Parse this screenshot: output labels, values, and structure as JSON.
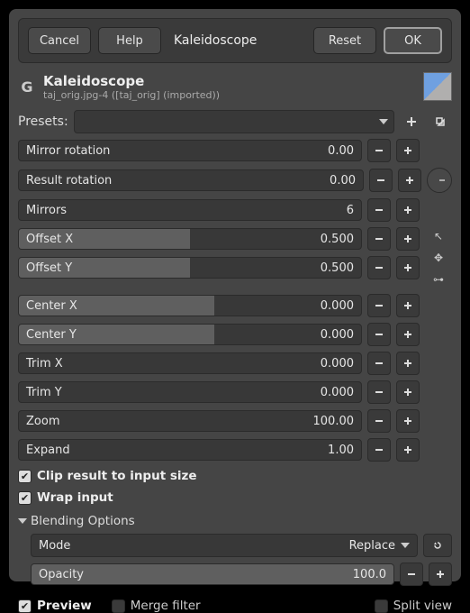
{
  "buttons": {
    "cancel": "Cancel",
    "help": "Help",
    "title": "Kaleidoscope",
    "reset": "Reset",
    "ok": "OK"
  },
  "header": {
    "filter_name": "Kaleidoscope",
    "subtitle": "taj_orig.jpg-4 ([taj_orig] (imported))"
  },
  "presets_label": "Presets:",
  "params": {
    "mirror_rotation": {
      "label": "Mirror rotation",
      "value": "0.00",
      "fill": 0
    },
    "result_rotation": {
      "label": "Result rotation",
      "value": "0.00",
      "fill": 0
    },
    "mirrors": {
      "label": "Mirrors",
      "value": "6",
      "fill": 0
    },
    "offset_x": {
      "label": "Offset X",
      "value": "0.500",
      "fill": 50
    },
    "offset_y": {
      "label": "Offset Y",
      "value": "0.500",
      "fill": 50
    },
    "center_x": {
      "label": "Center X",
      "value": "0.000",
      "fill": 57
    },
    "center_y": {
      "label": "Center Y",
      "value": "0.000",
      "fill": 57
    },
    "trim_x": {
      "label": "Trim X",
      "value": "0.000",
      "fill": 0
    },
    "trim_y": {
      "label": "Trim Y",
      "value": "0.000",
      "fill": 0
    },
    "zoom": {
      "label": "Zoom",
      "value": "100.00",
      "fill": 0
    },
    "expand": {
      "label": "Expand",
      "value": "1.00",
      "fill": 0
    }
  },
  "checks": {
    "clip": "Clip result to input size",
    "wrap": "Wrap input"
  },
  "blending": {
    "header": "Blending Options",
    "mode_label": "Mode",
    "mode_value": "Replace",
    "opacity_label": "Opacity",
    "opacity_value": "100.0"
  },
  "footer": {
    "preview": "Preview",
    "merge": "Merge filter",
    "split": "Split view"
  }
}
